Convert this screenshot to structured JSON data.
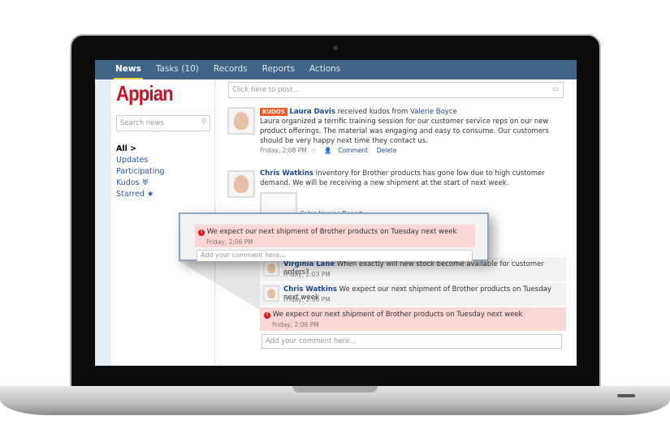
{
  "nav": {
    "tabs": [
      {
        "label": "News",
        "active": true
      },
      {
        "label": "Tasks (10)"
      },
      {
        "label": "Records"
      },
      {
        "label": "Reports"
      },
      {
        "label": "Actions"
      }
    ]
  },
  "sidebar": {
    "logo": "Appian",
    "search_placeholder": "Search news",
    "filters": [
      {
        "label": "All >"
      },
      {
        "label": "Updates"
      },
      {
        "label": "Participating"
      },
      {
        "label": "Kudos ♅"
      },
      {
        "label": "Starred ★"
      }
    ]
  },
  "post_placeholder": "Click here to post...",
  "feed": [
    {
      "badge": "KUDOS",
      "author": "Laura Davis",
      "verb": "received kudos from",
      "from": "Valerie Boyce",
      "text": "Laura organized a terrific training session for our customer service reps on our new product offerings. The material was engaging and easy to consume. Our customers should be very happy next time they contact us.",
      "time": "Friday, 2:08 PM",
      "comment": "Comment",
      "delete": "Delete"
    },
    {
      "author": "Chris Watkins",
      "text": "Inventory for Brother products has gone low due to high customer demand.  We will be receiving a new shipment at the start of next week.",
      "attachment": "Sales Invoice Report",
      "comments": [
        {
          "author": "Virginia Lane",
          "text": "When exactly will new stock become available for customer orders?",
          "time": "Friday, 2:03 PM"
        },
        {
          "author": "Chris Watkins",
          "text": "We expect our next shipment of Brother products on Tuesday next week",
          "time": "Friday, 2:06 PM"
        }
      ],
      "error": {
        "text": "We expect our next shipment of Brother products on Tuesday next week",
        "time": "Friday, 2:06 PM"
      },
      "add_comment_placeholder": "Add your comment here..."
    }
  ],
  "colors": {
    "nav": "#3f6485",
    "brand": "#c0162c",
    "kudos": "#f15a22",
    "error_bg": "#fdd6d6"
  }
}
